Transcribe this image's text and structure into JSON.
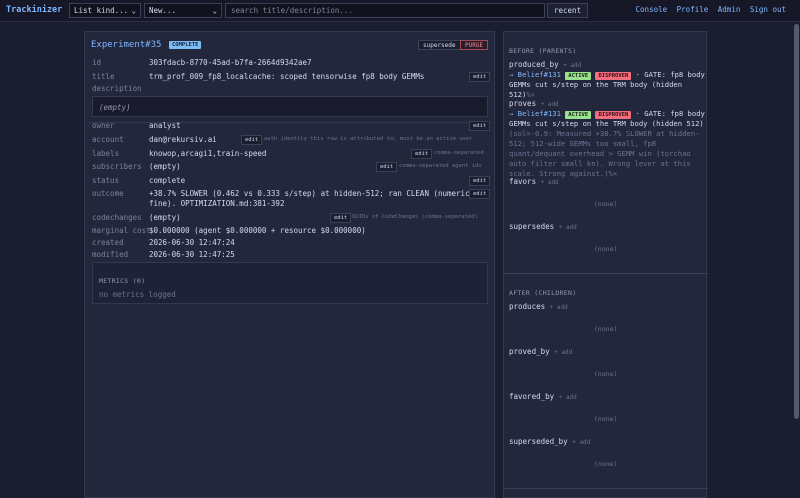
{
  "nav": {
    "brand": "Trackinizer",
    "kind_select": "List kind...",
    "new_select": "New...",
    "search_placeholder": "search title/description...",
    "recent_label": "recent",
    "links": [
      "Console",
      "Profile",
      "Admin",
      "Sign out"
    ]
  },
  "experiment": {
    "title": "Experiment#35",
    "status_badge": "COMPLETE",
    "supersede_label": "supersede",
    "purge_label": "PURGE",
    "fields": {
      "id": {
        "label": "id",
        "value": "303fdacb-8770-45ad-b7fa-2664d9342ae7"
      },
      "title": {
        "label": "title",
        "value": "trm_prof_009_fp8_localcache: scoped tensorwise fp8 body GEMMs"
      },
      "description": {
        "label": "description",
        "value": "(empty)"
      },
      "owner": {
        "label": "owner",
        "value": "analyst"
      },
      "account": {
        "label": "account",
        "value": "dan@rekursiv.ai",
        "hint": "auth identity this row is attributed to; must be an active user"
      },
      "labels": {
        "label": "labels",
        "value": "knowop,arcagi1,train-speed",
        "hint": "comma-separated"
      },
      "subscribers": {
        "label": "subscribers",
        "value": "(empty)",
        "hint": "comma-separated agent ids"
      },
      "status": {
        "label": "status",
        "value": "complete"
      },
      "outcome": {
        "label": "outcome",
        "value_line1": "+38.7% SLOWER (0.462 vs 0.333 s/step) at hidden-512; ran CLEAN (numerics",
        "value_line2": "fine). OPTIMIZATION.md:381-392"
      },
      "codechanges": {
        "label": "codechanges",
        "value": "(empty)",
        "hint": "UUIDs of CodeChanges (comma-separated)"
      },
      "marginal_cost": {
        "label": "marginal cost",
        "value": "$0.000000 (agent $0.000000 + resource $0.000000)"
      },
      "created": {
        "label": "created",
        "value": "2026-06-30 12:47:24"
      },
      "modified": {
        "label": "modified",
        "value": "2026-06-30 12:47:25"
      }
    },
    "edit_label": "edit",
    "metrics": {
      "title": "METRICS (0)",
      "empty": "no metrics logged"
    }
  },
  "relations": {
    "before_title": "BEFORE (PARENTS)",
    "after_title": "AFTER (CHILDREN)",
    "add_label": "+ add",
    "none_label": "(none)",
    "produced_by": {
      "name": "produced_by",
      "item": {
        "arrow": "→",
        "ref": "Belief#131",
        "badge1": "ACTIVE",
        "badge2": "DISPROVEN",
        "text": "· GATE: fp8 body GEMMs cut s/step on the TRM body (hidden 512)",
        "tail": "%×"
      }
    },
    "proves": {
      "name": "proves",
      "item": {
        "arrow": "→",
        "ref": "Belief#131",
        "badge1": "ACTIVE",
        "badge2": "DISPROVEN",
        "text": "· GATE: fp8 body GEMMs cut s/step on the TRM body (hidden 512)",
        "detail": "(sol=-0.9: Measured +38.7% SLOWER at hidden-512; 512-wide GEMMs too small, fp8 quant/dequant overhead > GEMM win (torchao auto filter small kn). Wrong lever at this scale. Strong against.)",
        "tail": "%×"
      }
    },
    "favors": {
      "name": "favors"
    },
    "supersedes": {
      "name": "supersedes"
    },
    "produces": {
      "name": "produces"
    },
    "proved_by": {
      "name": "proved_by"
    },
    "favored_by": {
      "name": "favored_by"
    },
    "superseded_by": {
      "name": "superseded_by"
    }
  }
}
